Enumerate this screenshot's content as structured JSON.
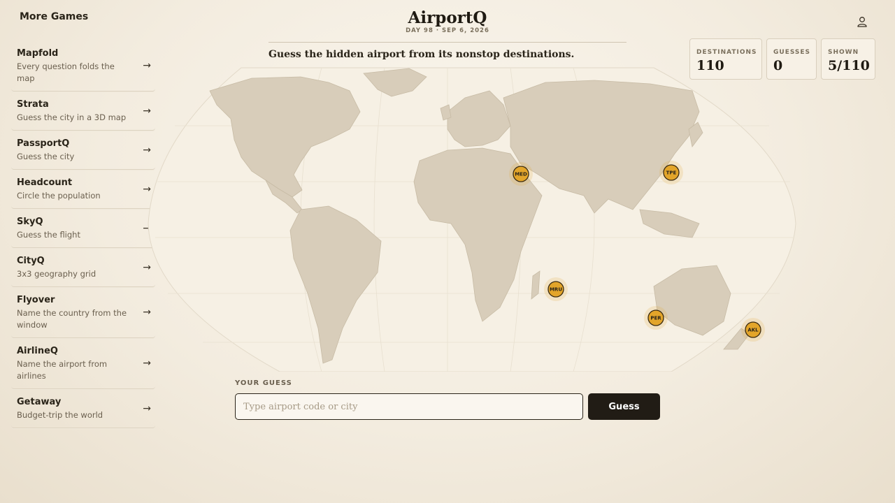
{
  "nav": {
    "more_games": "More Games"
  },
  "sidebar": {
    "items": [
      {
        "title": "Mapfold",
        "subtitle": "Every question folds the map",
        "arrow": "→"
      },
      {
        "title": "Strata",
        "subtitle": "Guess the city in a 3D map",
        "arrow": "→"
      },
      {
        "title": "PassportQ",
        "subtitle": "Guess the city",
        "arrow": "→"
      },
      {
        "title": "Headcount",
        "subtitle": "Circle the population",
        "arrow": "→"
      },
      {
        "title": "SkyQ",
        "subtitle": "Guess the flight",
        "arrow": "→"
      },
      {
        "title": "CityQ",
        "subtitle": "3x3 geography grid",
        "arrow": "→"
      },
      {
        "title": "Flyover",
        "subtitle": "Name the country from the window",
        "arrow": "→"
      },
      {
        "title": "AirlineQ",
        "subtitle": "Name the airport from airlines",
        "arrow": "→"
      },
      {
        "title": "Getaway",
        "subtitle": "Budget-trip the world",
        "arrow": "→"
      }
    ]
  },
  "header": {
    "title": "AirportQ",
    "subtitle": "DAY 98 · SEP 6, 2026",
    "prompt": "Guess the hidden airport from its nonstop destinations."
  },
  "stats": {
    "destinations": {
      "label": "DESTINATIONS",
      "value": "110"
    },
    "guesses": {
      "label": "GUESSES",
      "value": "0"
    },
    "shown": {
      "label": "SHOWN",
      "value": "5/110"
    }
  },
  "map": {
    "pins": [
      {
        "code": "MED"
      },
      {
        "code": "TPE"
      },
      {
        "code": "MRU"
      },
      {
        "code": "PER"
      },
      {
        "code": "AKL"
      }
    ],
    "colors": {
      "pin": "#e3a52a",
      "land": "#d9cebb",
      "ocean": "#f5efe3"
    }
  },
  "guess": {
    "label": "YOUR GUESS",
    "placeholder": "Type airport code or city",
    "button_label": "Guess"
  },
  "icons": {
    "account": "user-icon",
    "arrow": "arrow-right-icon"
  }
}
